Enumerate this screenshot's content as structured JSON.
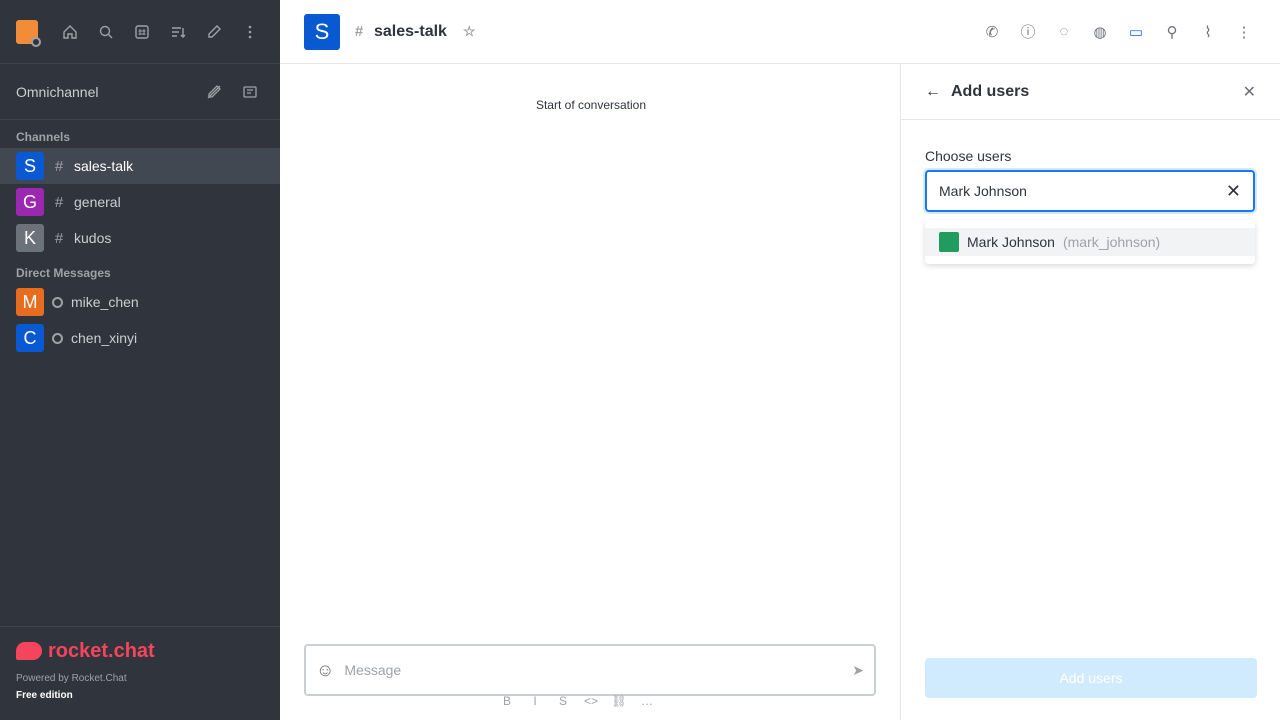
{
  "sidebar": {
    "omnichannel_label": "Omnichannel",
    "channels_header": "Channels",
    "channels": [
      {
        "initial": "S",
        "name": "sales-talk",
        "color": "#095ad2",
        "active": true
      },
      {
        "initial": "G",
        "name": "general",
        "color": "#9c27b0",
        "active": false
      },
      {
        "initial": "K",
        "name": "kudos",
        "color": "#6c727a",
        "active": false
      }
    ],
    "dm_header": "Direct Messages",
    "dms": [
      {
        "initial": "M",
        "name": "mike_chen",
        "color": "#e86c1e"
      },
      {
        "initial": "C",
        "name": "chen_xinyi",
        "color": "#095ad2"
      }
    ],
    "footer": {
      "logo_text": "rocket.chat",
      "powered": "Powered by Rocket.Chat",
      "edition": "Free edition"
    }
  },
  "header": {
    "room_initial": "S",
    "room_name": "sales-talk"
  },
  "conversation": {
    "start_label": "Start of conversation",
    "composer_placeholder": "Message"
  },
  "panel": {
    "title": "Add users",
    "choose_label": "Choose users",
    "input_value": "Mark Johnson",
    "suggestion": {
      "name": "Mark Johnson",
      "username": "(mark_johnson)"
    },
    "add_button": "Add users"
  },
  "colors": {
    "sidebar_bg": "#2f343d",
    "accent": "#1d74f5",
    "add_button_bg": "#d1ebfe"
  }
}
